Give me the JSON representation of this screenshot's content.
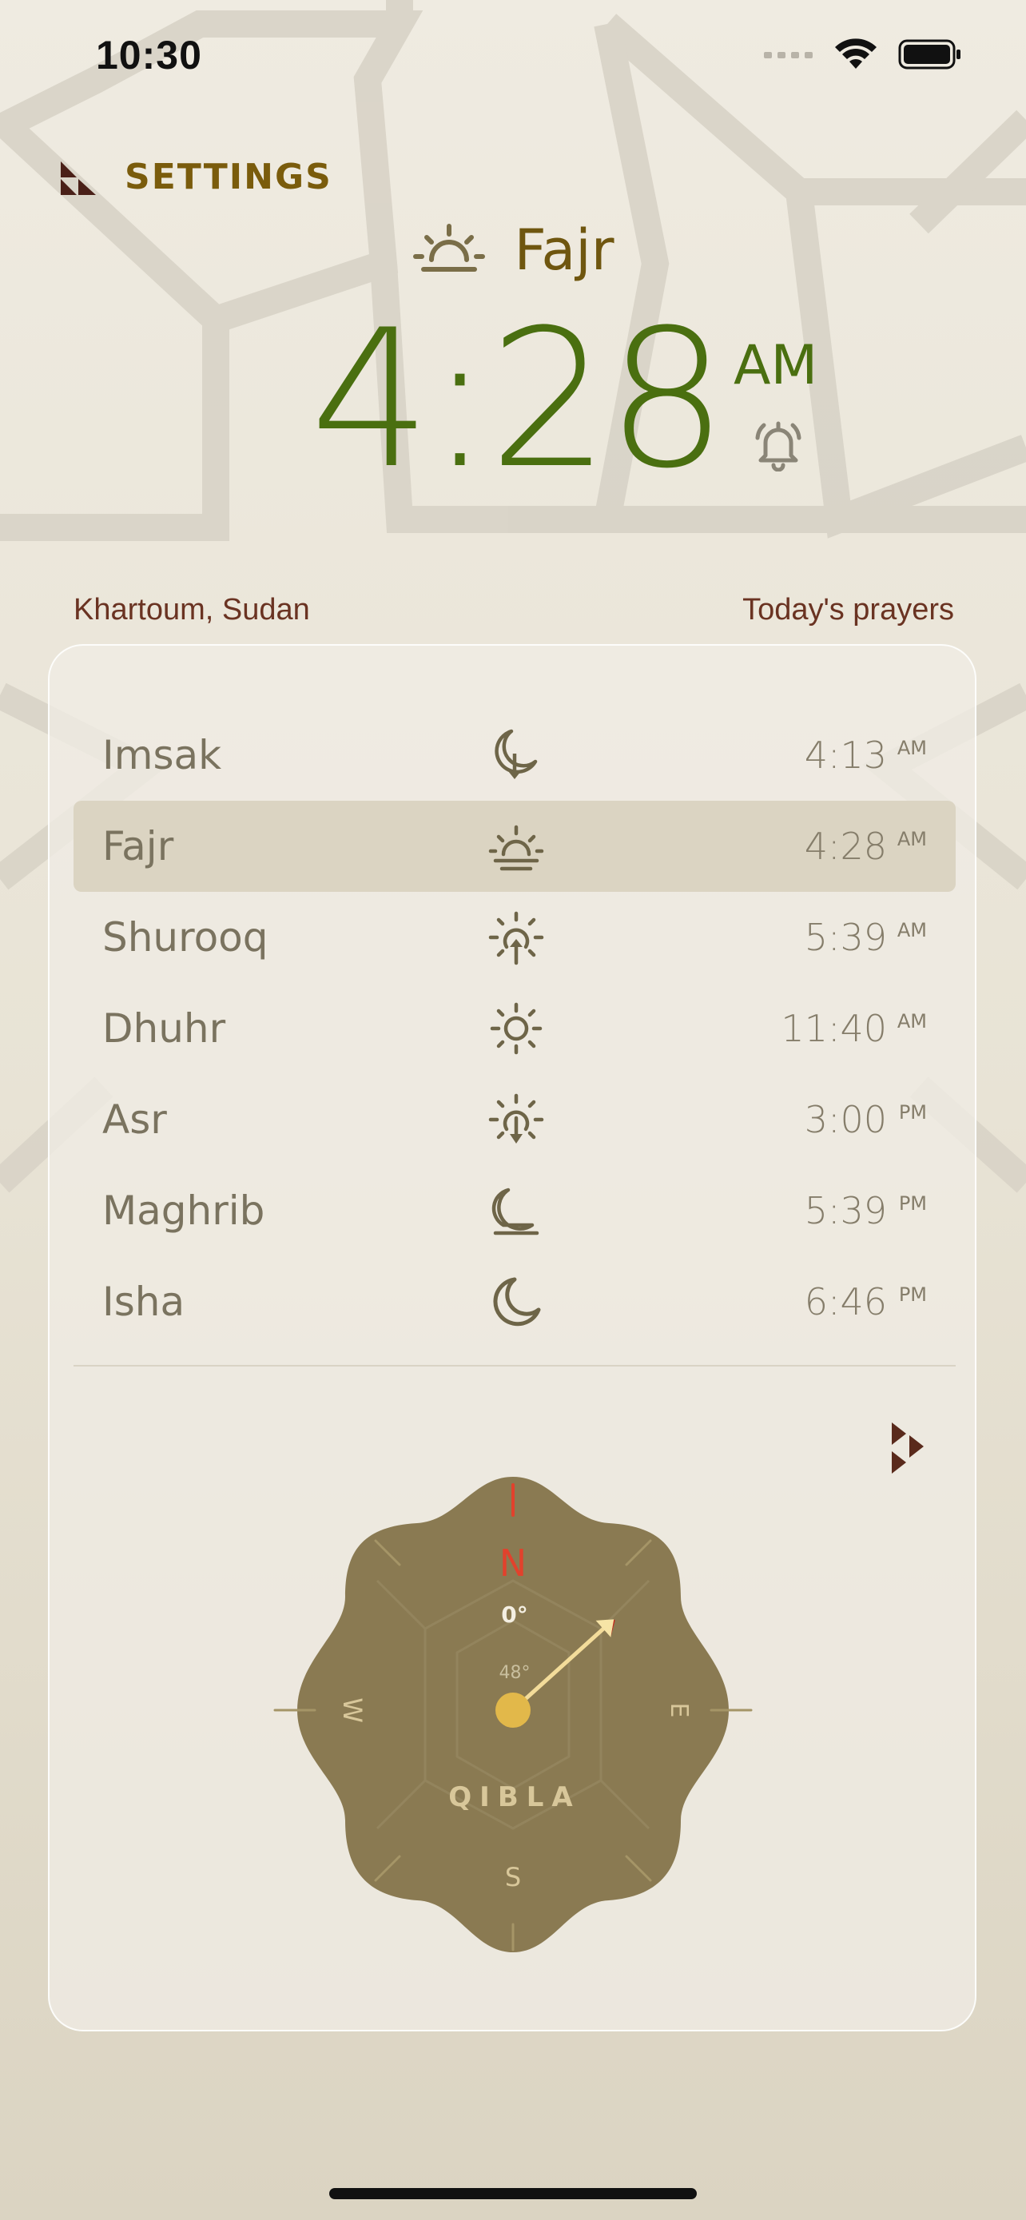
{
  "status_bar": {
    "time": "10:30"
  },
  "settings": {
    "label": "SETTINGS"
  },
  "current": {
    "prayer": "Fajr",
    "time": "4:28",
    "ampm": "AM"
  },
  "location": "Khartoum, Sudan",
  "todays_label": "Today's prayers",
  "prayers": [
    {
      "name": "Imsak",
      "time": "4:13",
      "ampm": "AM",
      "icon": "moon-down-icon"
    },
    {
      "name": "Fajr",
      "time": "4:28",
      "ampm": "AM",
      "icon": "sunrise-horizon-icon"
    },
    {
      "name": "Shurooq",
      "time": "5:39",
      "ampm": "AM",
      "icon": "sun-up-icon"
    },
    {
      "name": "Dhuhr",
      "time": "11:40",
      "ampm": "AM",
      "icon": "sun-icon"
    },
    {
      "name": "Asr",
      "time": "3:00",
      "ampm": "PM",
      "icon": "sun-down-icon"
    },
    {
      "name": "Maghrib",
      "time": "5:39",
      "ampm": "PM",
      "icon": "moon-horizon-icon"
    },
    {
      "name": "Isha",
      "time": "6:46",
      "ampm": "PM",
      "icon": "moon-icon"
    }
  ],
  "active_prayer_index": 1,
  "compass": {
    "north": "N",
    "east": "E",
    "south": "S",
    "west": "W",
    "heading": "0°",
    "qibla_angle": "48°",
    "label": "QIBLA",
    "qibla_bearing_deg": 48
  },
  "colors": {
    "accent_green": "#4a6f10",
    "gold": "#7a5c0c",
    "compass_bg": "#8a7a52",
    "north_red": "#e2412c"
  }
}
